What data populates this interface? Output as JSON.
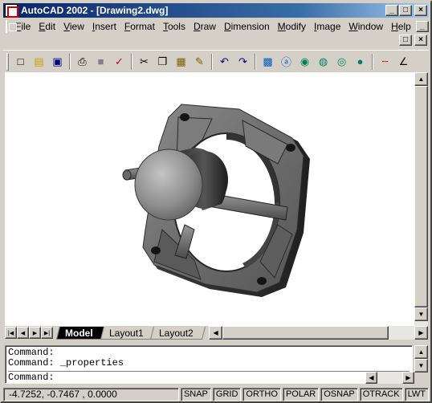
{
  "window": {
    "title": "AutoCAD 2002 - [Drawing2.dwg]",
    "caption_buttons": [
      "_",
      "□",
      "×"
    ]
  },
  "menubar": {
    "items": [
      "File",
      "Edit",
      "View",
      "Insert",
      "Format",
      "Tools",
      "Draw",
      "Dimension",
      "Modify",
      "Image",
      "Window",
      "Help"
    ],
    "mdi_buttons": [
      "_",
      "□",
      "×"
    ]
  },
  "toolbar": {
    "icons": [
      {
        "name": "new-icon",
        "glyph": "□"
      },
      {
        "name": "open-icon",
        "glyph": "▤"
      },
      {
        "name": "save-icon",
        "glyph": "▣"
      },
      {
        "name": "print-icon",
        "glyph": "⎙"
      },
      {
        "name": "print-preview-icon",
        "glyph": "■"
      },
      {
        "name": "spell-check-icon",
        "glyph": "✓"
      },
      {
        "name": "cut-icon",
        "glyph": "✂"
      },
      {
        "name": "copy-icon",
        "glyph": "❐"
      },
      {
        "name": "paste-icon",
        "glyph": "▦"
      },
      {
        "name": "match-properties-icon",
        "glyph": "✎"
      },
      {
        "name": "undo-icon",
        "glyph": "↶"
      },
      {
        "name": "redo-icon",
        "glyph": "↷"
      },
      {
        "name": "design-center-icon",
        "glyph": "▩"
      },
      {
        "name": "hyperlink-icon",
        "glyph": "ⓐ"
      },
      {
        "name": "web-icon",
        "glyph": "◉"
      },
      {
        "name": "web-open-icon",
        "glyph": "◍"
      },
      {
        "name": "web-save-icon",
        "glyph": "◎"
      },
      {
        "name": "web-publish-icon",
        "glyph": "●"
      },
      {
        "name": "tracking-icon",
        "glyph": "┄"
      },
      {
        "name": "ucs-icon",
        "glyph": "∠"
      }
    ]
  },
  "layout_tabs": {
    "tabs": [
      "Model",
      "Layout1",
      "Layout2"
    ],
    "active": "Model"
  },
  "command_window": {
    "lines": [
      "Command:",
      "Command: _properties"
    ],
    "input_line": "Command:"
  },
  "statusbar": {
    "coordinates": "-4.7252, -0.7467 , 0.0000",
    "toggles": [
      "SNAP",
      "GRID",
      "ORTHO",
      "POLAR",
      "OSNAP",
      "OTRACK",
      "LWT"
    ]
  }
}
